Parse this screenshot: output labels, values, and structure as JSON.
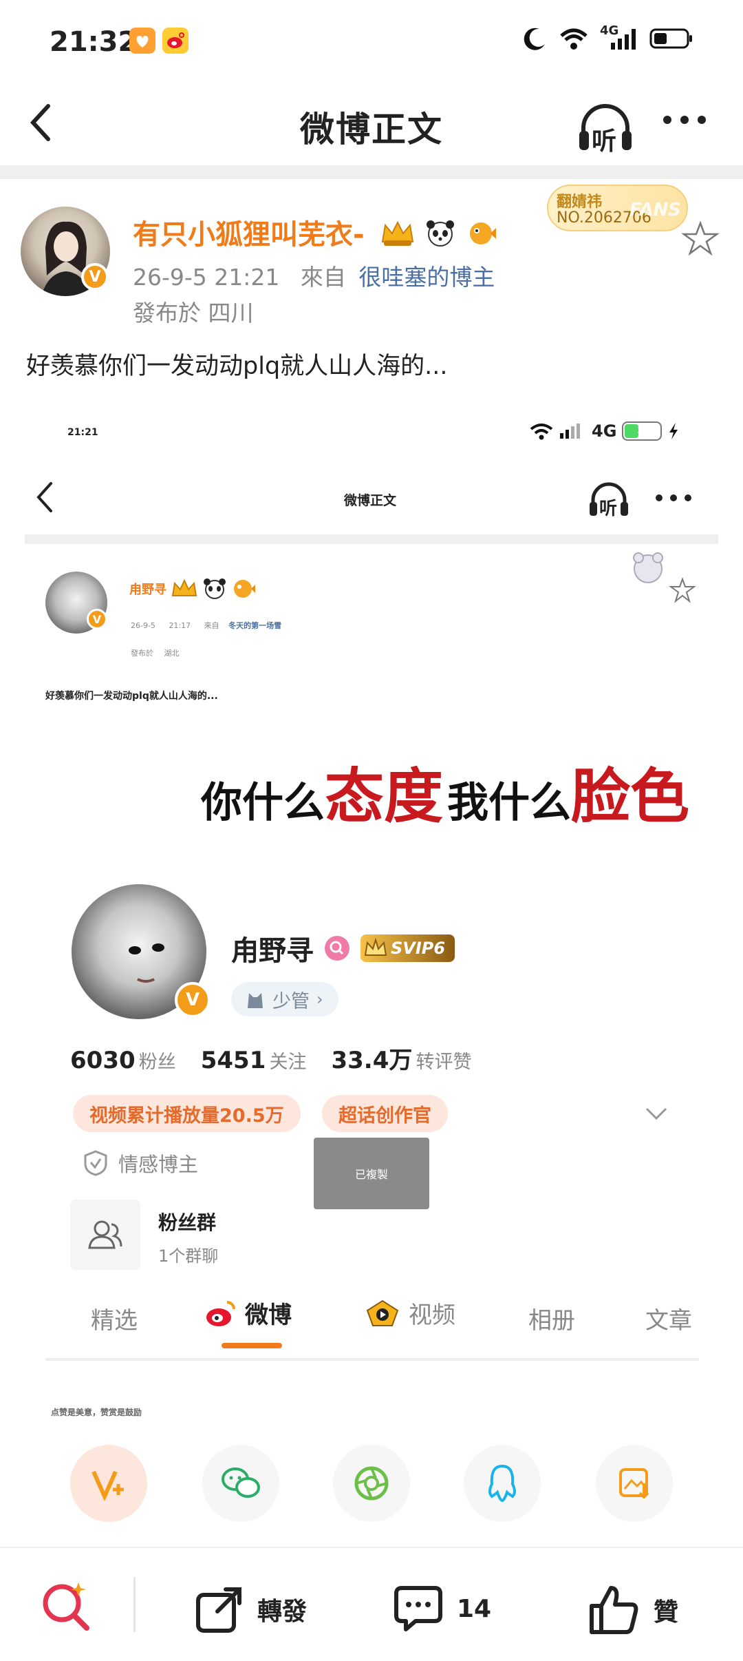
{
  "status_bar": {
    "time": "21:32",
    "network": "4G"
  },
  "nav": {
    "title": "微博正文",
    "listen_label": "听"
  },
  "post": {
    "username": "有只小狐狸叫芜衣-",
    "date": "26-9-5 21:21",
    "source_prefix": "來自",
    "source": "很哇塞的博主",
    "location": "發布於 四川",
    "fans_badge_name": "翻婧祎",
    "fans_badge_number": "NO.2062706",
    "fans_badge_text": "FANS",
    "text": "好羡慕你们一发动动plq就人山人海的..."
  },
  "embedded": {
    "status_time": "21:21",
    "status_network": "4G",
    "battery_level": "35",
    "nav_title": "微博正文",
    "listen_label": "听",
    "username": "甪野寻",
    "date": "26-9-5",
    "time": "21:17",
    "source_prefix": "来自",
    "source": "冬天的第一场雪",
    "location_prefix": "發布於",
    "location": "湖北",
    "post_text": "好羡慕你们一发动动plq就人山人海的...",
    "meme_part1": "你什么",
    "meme_part2": "态度",
    "meme_part3": "我什么",
    "meme_part4": "脸色",
    "profile_name": "甪野寻",
    "svip": "SVIP6",
    "role": "少管",
    "stats": [
      {
        "value": "6030",
        "label": "粉丝"
      },
      {
        "value": "5451",
        "label": "关注"
      },
      {
        "value": "33.4万",
        "label": "转评赞"
      }
    ],
    "tags": [
      "视频累计播放量20.5万",
      "超话创作官"
    ],
    "category": "情感博主",
    "fan_group_title": "粉丝群",
    "fan_group_sub": "1个群聊",
    "toast": "已複製",
    "tabs": [
      "精选",
      "微博",
      "视频",
      "相册",
      "文章"
    ],
    "share_caption": "点赞是美意，赞赏是鼓励"
  },
  "bottom_bar": {
    "forward_label": "轉發",
    "comment_count": "14",
    "like_label": "贊"
  },
  "colors": {
    "username_orange": "#f07b1a",
    "source_blue": "#4a6fa5",
    "meme_red": "#c8191e",
    "tab_active_underline": "#f07b1a"
  }
}
